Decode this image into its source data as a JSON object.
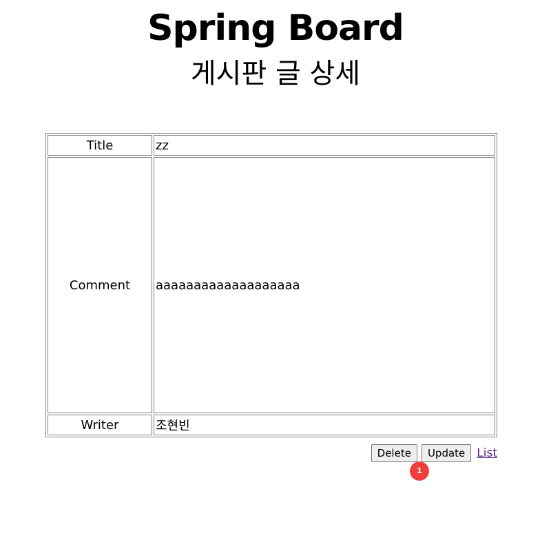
{
  "header": {
    "brand": "Spring Board",
    "subtitle": "게시판 글 상세"
  },
  "detail": {
    "rows": [
      {
        "label": "Title",
        "value": "zz"
      },
      {
        "label": "Comment",
        "value": "aaaaaaaaaaaaaaaaaaa"
      },
      {
        "label": "Writer",
        "value": "조현빈"
      }
    ]
  },
  "actions": {
    "delete_label": "Delete",
    "update_label": "Update",
    "list_label": "List"
  },
  "marker": {
    "badge_text": "1"
  },
  "colors": {
    "link": "#551a8b",
    "badge": "#f03e3e",
    "border": "#808080"
  }
}
